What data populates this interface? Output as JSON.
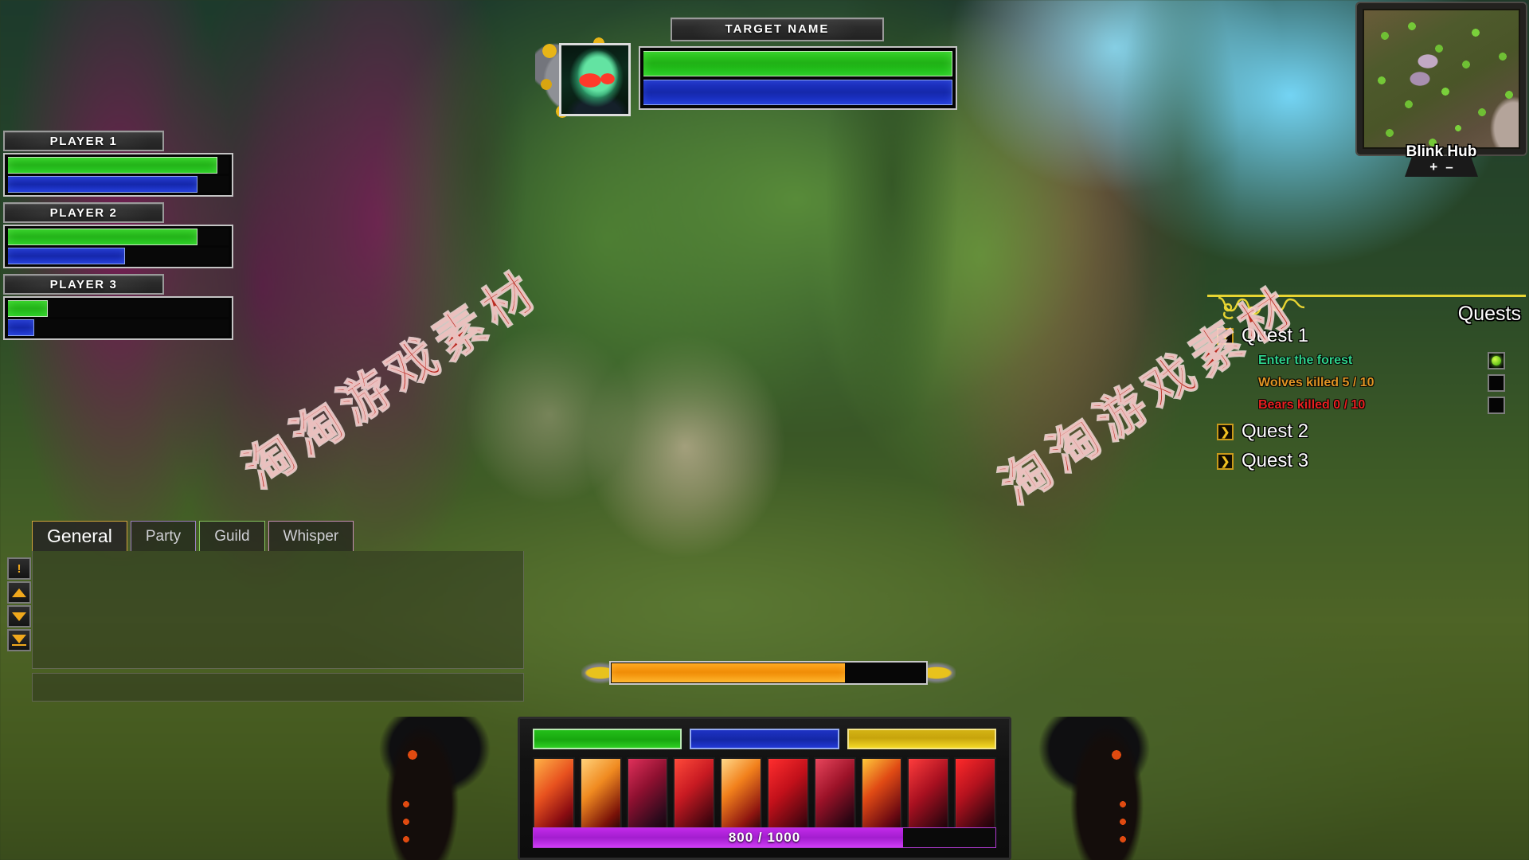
{
  "target": {
    "name": "TARGET NAME",
    "portrait_icon": "undead-orc-portrait",
    "health_pct": 100,
    "mana_pct": 100
  },
  "party": [
    {
      "name": "PLAYER 1",
      "health_pct": 95,
      "mana_pct": 86
    },
    {
      "name": "PLAYER 2",
      "health_pct": 86,
      "mana_pct": 53
    },
    {
      "name": "PLAYER 3",
      "health_pct": 18,
      "mana_pct": 12
    }
  ],
  "minimap": {
    "zone_label": "Blink Hub",
    "zoom_in": "+",
    "zoom_out": "–"
  },
  "quests": {
    "title": "Quests",
    "items": [
      {
        "label": "Quest 1",
        "expanded": true,
        "toggle_icon": "chevron-down-icon"
      },
      {
        "label": "Quest 2",
        "expanded": false,
        "toggle_icon": "chevron-right-icon"
      },
      {
        "label": "Quest 3",
        "expanded": false,
        "toggle_icon": "chevron-right-icon"
      }
    ],
    "objectives": [
      {
        "text": "Enter the forest",
        "color": "#2fd18a",
        "complete": true
      },
      {
        "text": "Wolves killed 5 / 10",
        "color": "#e09424",
        "complete": false
      },
      {
        "text": "Bears killed 0 / 10",
        "color": "#e62020",
        "complete": false
      }
    ]
  },
  "chat": {
    "tabs": [
      {
        "label": "General",
        "active": true
      },
      {
        "label": "Party",
        "active": false
      },
      {
        "label": "Guild",
        "active": false
      },
      {
        "label": "Whisper",
        "active": false
      }
    ],
    "log_lines": [],
    "input_value": "",
    "side_buttons": [
      {
        "icon": "alert-exclamation-icon"
      },
      {
        "icon": "scroll-up-icon"
      },
      {
        "icon": "scroll-down-icon"
      },
      {
        "icon": "scroll-to-bottom-icon"
      }
    ]
  },
  "castbar": {
    "progress_pct": 74
  },
  "action_bar": {
    "resources": [
      {
        "name": "health",
        "pct": 100,
        "color": "#22bf18"
      },
      {
        "name": "mana",
        "pct": 100,
        "color": "#1e33c4"
      },
      {
        "name": "energy",
        "pct": 100,
        "color": "#d8b816"
      }
    ],
    "slots": [
      {
        "icon": "dagger-blade-ability"
      },
      {
        "icon": "bleeding-sword-ability"
      },
      {
        "icon": "dark-axe-ability"
      },
      {
        "icon": "clenched-fist-ability"
      },
      {
        "icon": "impaling-spear-ability"
      },
      {
        "icon": "blood-slash-ability"
      },
      {
        "icon": "chain-hook-ability"
      },
      {
        "icon": "flame-cloak-ability"
      },
      {
        "icon": "shadow-claw-ability"
      },
      {
        "icon": "demon-summon-ability"
      }
    ],
    "xp": {
      "text": "800 / 1000",
      "pct": 80
    }
  },
  "watermark": {
    "text": "淘淘游戏素材"
  },
  "colors": {
    "health": "#22bf18",
    "mana": "#1e33c4",
    "energy": "#d8b816",
    "xp": "#c12ae8",
    "cast": "#ffa317",
    "quest_gold": "#e7d432"
  }
}
